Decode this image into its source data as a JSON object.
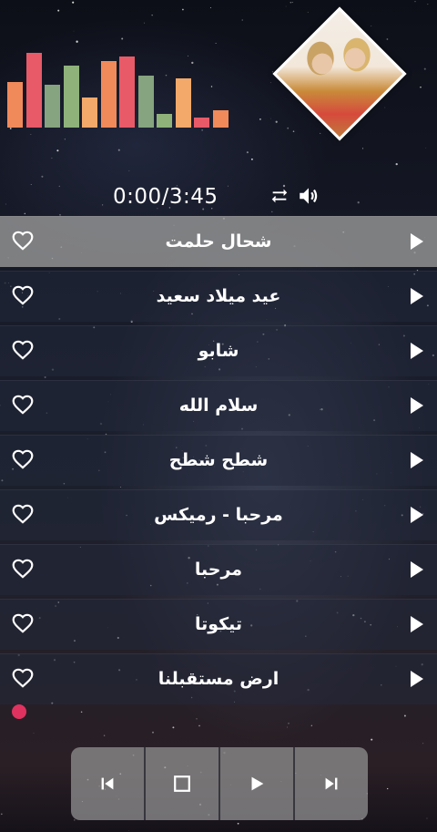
{
  "player": {
    "time_display": "0:00/3:45",
    "visualizer_levels": [
      0.61,
      1.0,
      0.57,
      0.83,
      0.4,
      0.89,
      0.95,
      0.7,
      0.18,
      0.66,
      0.13,
      0.23
    ],
    "visualizer_colors": [
      "#f08a5a",
      "#e85a68",
      "#86a47f",
      "#8fb27a",
      "#f2a96a",
      "#f08a5a",
      "#e85a68",
      "#86a47f",
      "#8fb27a",
      "#f2a96a",
      "#e85a68",
      "#f08a5a"
    ]
  },
  "songs": [
    {
      "title": "شحال حلمت",
      "active": true
    },
    {
      "title": "عيد ميلاد سعيد",
      "active": false
    },
    {
      "title": "شابو",
      "active": false
    },
    {
      "title": "سلام الله",
      "active": false
    },
    {
      "title": "شطح شطح",
      "active": false
    },
    {
      "title": "مرحبا - رميكس",
      "active": false
    },
    {
      "title": "مرحبا",
      "active": false
    },
    {
      "title": "تيكوتا",
      "active": false
    },
    {
      "title": "ارض مستقبلنا",
      "active": false
    }
  ],
  "icons": {
    "favorite": "heart-outline-icon",
    "play_row": "play-triangle-icon",
    "repeat": "repeat-icon",
    "volume": "volume-icon",
    "previous": "skip-previous-icon",
    "stop": "stop-icon",
    "play": "play-icon",
    "next": "skip-next-icon"
  },
  "colors": {
    "accent": "#e0325f",
    "active_row": "#969696",
    "control_bg": "#969696"
  }
}
